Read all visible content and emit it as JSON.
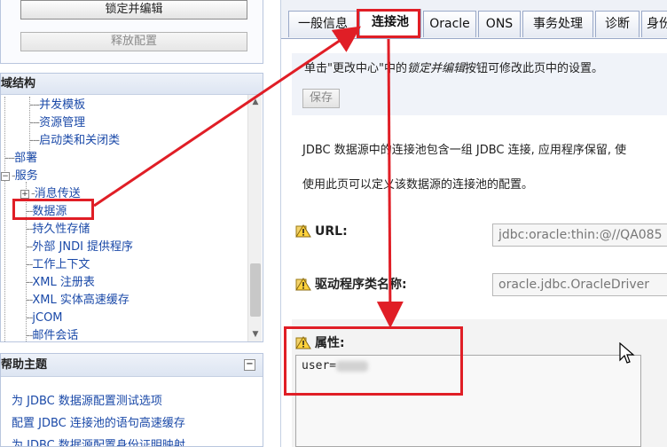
{
  "left": {
    "lock_button": "锁定并编辑",
    "release_button": "释放配置",
    "tree_title": "域结构",
    "tree_items": [
      {
        "label": "并发模板"
      },
      {
        "label": "资源管理"
      },
      {
        "label": "启动类和关闭类"
      },
      {
        "label": "部署"
      },
      {
        "label": "服务"
      },
      {
        "label": "消息传送"
      },
      {
        "label": "数据源"
      },
      {
        "label": "持久性存储"
      },
      {
        "label": "外部 JNDI 提供程序"
      },
      {
        "label": "工作上下文"
      },
      {
        "label": "XML 注册表"
      },
      {
        "label": "XML 实体高速缓存"
      },
      {
        "label": "jCOM"
      },
      {
        "label": "邮件会话"
      }
    ],
    "help_title": "帮助主题",
    "help_links": [
      "为 JDBC 数据源配置测试选项",
      "配置 JDBC 连接池的语句高速缓存",
      "为 JDBC 数据源配置身份证明映射"
    ]
  },
  "tabs": [
    "一般信息",
    "连接池",
    "Oracle",
    "ONS",
    "事务处理",
    "诊断",
    "身份"
  ],
  "active_tab": "连接池",
  "notice": {
    "prefix": "单击\"更改中心\"中的",
    "emph": "锁定并编辑",
    "suffix": "按钮可修改此页中的设置。"
  },
  "save_button": "保存",
  "descriptions": [
    "JDBC 数据源中的连接池包含一组 JDBC 连接, 应用程序保留, 使",
    "使用此页可以定义该数据源的连接池的配置。"
  ],
  "fields": {
    "url": {
      "label": "URL:",
      "value": "jdbc:oracle:thin:@//QA085"
    },
    "driver": {
      "label": "驱动程序类名称:",
      "value": "oracle.jdbc.OracleDriver"
    },
    "properties": {
      "label": "属性:",
      "value": "user="
    }
  },
  "colors": {
    "highlight": "#e01e26",
    "link": "#1a49a8",
    "border": "#9aa9c8"
  }
}
